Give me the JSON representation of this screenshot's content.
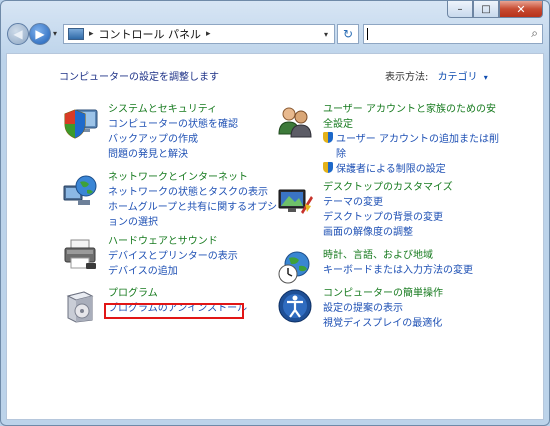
{
  "window": {
    "min_glyph": "–",
    "max_glyph": "□",
    "close_glyph": "✕"
  },
  "nav": {
    "back_glyph": "◀",
    "forward_glyph": "▶"
  },
  "address": {
    "separator": "▸",
    "path": "コントロール パネル",
    "separator2": "▸",
    "dropdown_glyph": "▾",
    "refresh_glyph": "↻"
  },
  "search": {
    "value": "",
    "icon_glyph": "⌕"
  },
  "main": {
    "heading": "コンピューターの設定を調整します",
    "view_by_label": "表示方法:",
    "view_by_value": "カテゴリ",
    "view_by_glyph": "▾"
  },
  "categories": {
    "system": {
      "title": "システムとセキュリティ",
      "links": [
        "コンピューターの状態を確認",
        "バックアップの作成",
        "問題の発見と解決"
      ]
    },
    "network": {
      "title": "ネットワークとインターネット",
      "links": [
        "ネットワークの状態とタスクの表示",
        "ホームグループと共有に関するオプシ",
        "ョンの選択"
      ]
    },
    "hardware": {
      "title": "ハードウェアとサウンド",
      "links": [
        "デバイスとプリンターの表示",
        "デバイスの追加"
      ]
    },
    "programs": {
      "title": "プログラム",
      "links": [
        "プログラムのアンインストール"
      ]
    },
    "users": {
      "title_line1": "ユーザー アカウントと家族のための安",
      "title_line2": "全設定",
      "links": [
        "ユーザー アカウントの追加または削",
        "除",
        "保護者による制限の設定"
      ]
    },
    "appearance": {
      "title": "デスクトップのカスタマイズ",
      "links": [
        "テーマの変更",
        "デスクトップの背景の変更",
        "画面の解像度の調整"
      ]
    },
    "clock": {
      "title": "時計、言語、および地域",
      "links": [
        "キーボードまたは入力方法の変更"
      ]
    },
    "ease": {
      "title": "コンピューターの簡単操作",
      "links": [
        "設定の提案の表示",
        "視覚ディスプレイの最適化"
      ]
    }
  },
  "colors": {
    "category_title": "#167a1e",
    "link": "#1e50b4",
    "heading": "#1e3287",
    "highlight_box": "#e11616"
  },
  "icons": {
    "system": "shield-pc-icon",
    "network": "globe-network-icon",
    "hardware": "printer-icon",
    "programs": "program-box-icon",
    "users": "users-icon",
    "appearance": "monitor-paint-icon",
    "clock": "clock-globe-icon",
    "ease": "ease-of-access-icon",
    "uac": "uac-shield-icon"
  }
}
